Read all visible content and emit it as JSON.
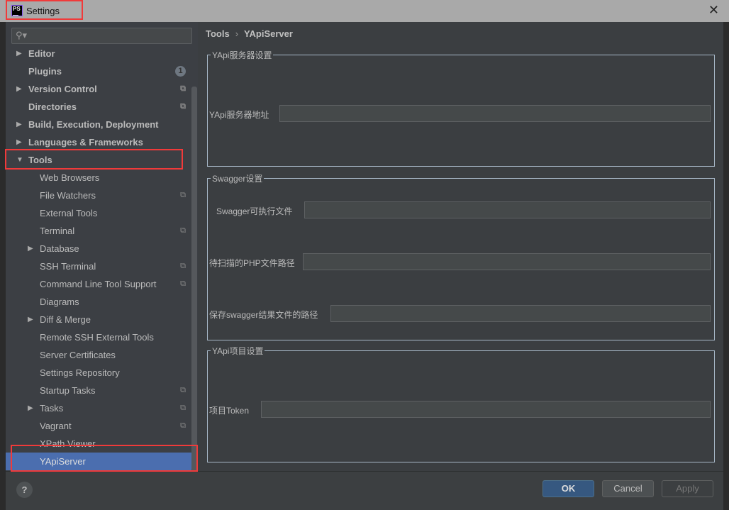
{
  "window": {
    "title": "Settings",
    "logo": "PS"
  },
  "search": {
    "placeholder": "",
    "icon": "search-icon"
  },
  "sidebar": {
    "items": [
      {
        "label": "Editor",
        "bold": true,
        "arrow": "right"
      },
      {
        "label": "Plugins",
        "bold": true,
        "badge": "1"
      },
      {
        "label": "Version Control",
        "bold": true,
        "arrow": "right",
        "project_icon": true
      },
      {
        "label": "Directories",
        "bold": true,
        "project_icon": true
      },
      {
        "label": "Build, Execution, Deployment",
        "bold": true,
        "arrow": "right"
      },
      {
        "label": "Languages & Frameworks",
        "bold": true,
        "arrow": "right"
      },
      {
        "label": "Tools",
        "bold": true,
        "arrow": "down"
      },
      {
        "label": "Web Browsers",
        "indent": 1
      },
      {
        "label": "File Watchers",
        "indent": 1,
        "project_icon": true
      },
      {
        "label": "External Tools",
        "indent": 1
      },
      {
        "label": "Terminal",
        "indent": 1,
        "project_icon": true
      },
      {
        "label": "Database",
        "indent": 1,
        "arrow": "right"
      },
      {
        "label": "SSH Terminal",
        "indent": 1,
        "project_icon": true
      },
      {
        "label": "Command Line Tool Support",
        "indent": 1,
        "project_icon": true
      },
      {
        "label": "Diagrams",
        "indent": 1
      },
      {
        "label": "Diff & Merge",
        "indent": 1,
        "arrow": "right"
      },
      {
        "label": "Remote SSH External Tools",
        "indent": 1
      },
      {
        "label": "Server Certificates",
        "indent": 1
      },
      {
        "label": "Settings Repository",
        "indent": 1
      },
      {
        "label": "Startup Tasks",
        "indent": 1,
        "project_icon": true
      },
      {
        "label": "Tasks",
        "indent": 1,
        "arrow": "right",
        "project_icon": true
      },
      {
        "label": "Vagrant",
        "indent": 1,
        "project_icon": true
      },
      {
        "label": "XPath Viewer",
        "indent": 1
      },
      {
        "label": "YApiServer",
        "indent": 1,
        "selected": true
      }
    ]
  },
  "breadcrumb": {
    "parent": "Tools",
    "separator": "›",
    "current": "YApiServer"
  },
  "groups": [
    {
      "title": "YApi服务器设置",
      "fields": [
        {
          "label": "YApi服务器地址",
          "value": ""
        }
      ]
    },
    {
      "title": "Swagger设置",
      "fields": [
        {
          "label": "Swagger可执行文件",
          "value": ""
        },
        {
          "label": "待扫描的PHP文件路径",
          "value": ""
        },
        {
          "label": "保存swagger结果文件的路径",
          "value": ""
        }
      ]
    },
    {
      "title": "YApi项目设置",
      "fields": [
        {
          "label": "项目Token",
          "value": ""
        }
      ]
    }
  ],
  "buttons": {
    "help": "?",
    "ok": "OK",
    "cancel": "Cancel",
    "apply": "Apply"
  },
  "colors": {
    "selection": "#4b6eaf",
    "ok_button": "#365880",
    "annotation": "#f03a3a"
  }
}
